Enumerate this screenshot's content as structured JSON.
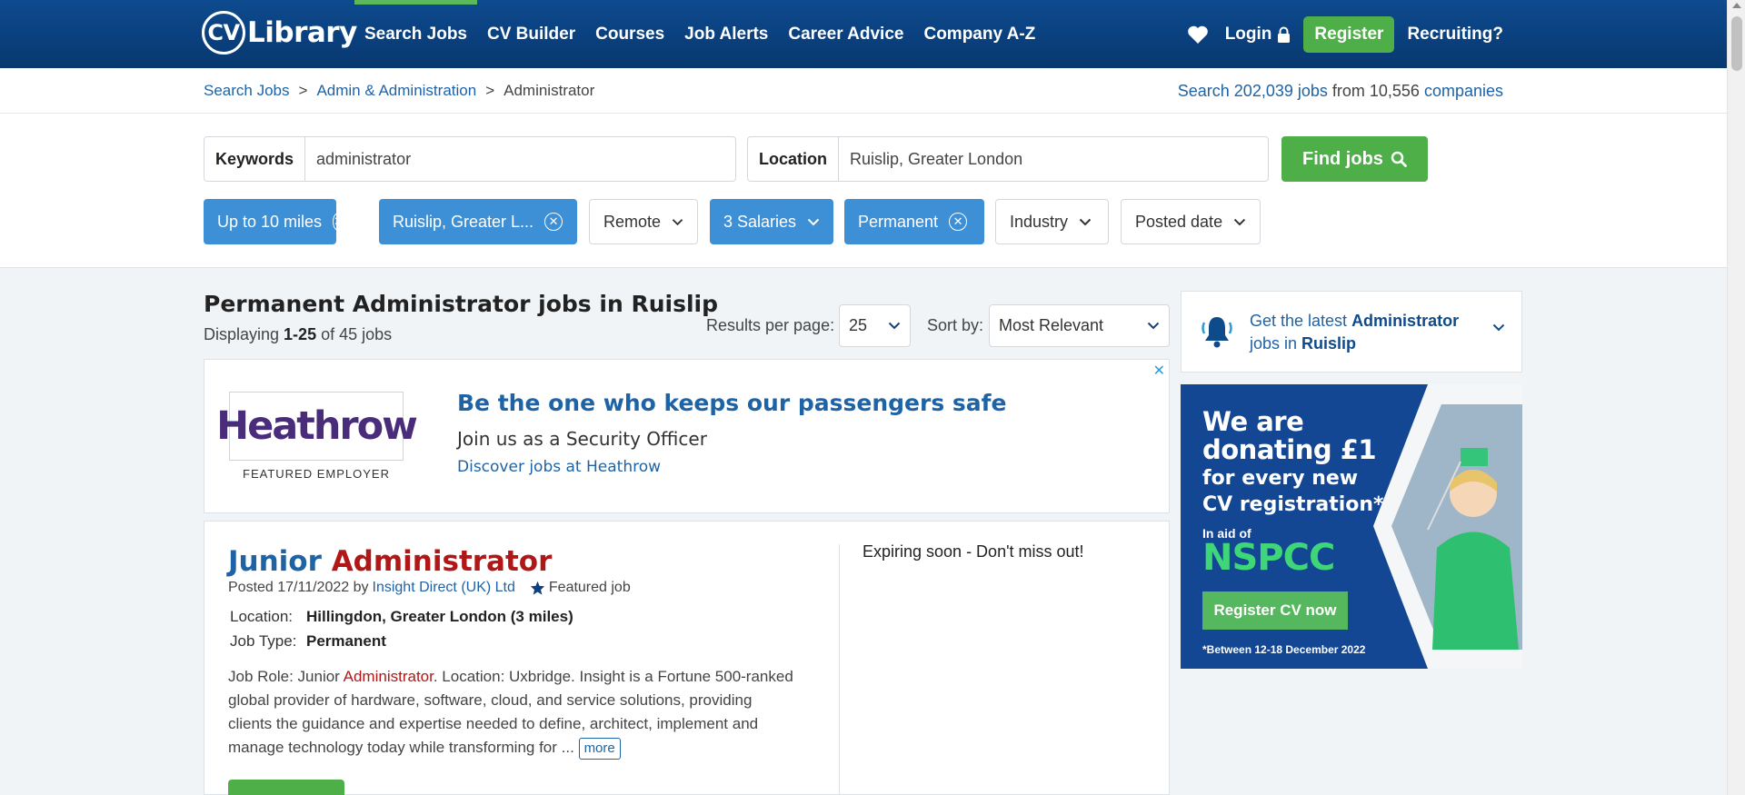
{
  "header": {
    "logo_text": "Library",
    "logo_badge": "CV",
    "nav": [
      "Search Jobs",
      "CV Builder",
      "Courses",
      "Job Alerts",
      "Career Advice",
      "Company A-Z"
    ],
    "login": "Login",
    "register": "Register",
    "recruiting": "Recruiting?"
  },
  "breadcrumb": {
    "items": [
      "Search Jobs",
      "Admin & Administration",
      "Administrator"
    ],
    "separator": ">"
  },
  "stats": {
    "prefix": "Search ",
    "jobs": "202,039 jobs",
    "middle": " from 10,556 ",
    "companies": "companies"
  },
  "search": {
    "keywords_label": "Keywords",
    "keywords_value": "administrator",
    "location_label": "Location",
    "location_value": "Ruislip, Greater London",
    "find_button": "Find jobs"
  },
  "filters": [
    {
      "label": "Up to 10 miles",
      "active": true
    },
    {
      "label": "Ruislip, Greater L...",
      "active": true
    },
    {
      "label": "Remote",
      "active": false
    },
    {
      "label": "3 Salaries",
      "active": true,
      "dropdown": true
    },
    {
      "label": "Permanent",
      "active": true
    },
    {
      "label": "Industry",
      "active": false
    },
    {
      "label": "Posted date",
      "active": false
    }
  ],
  "results": {
    "title": "Permanent Administrator jobs in Ruislip",
    "displaying_prefix": "Displaying ",
    "displaying_range": "1-25",
    "displaying_suffix": " of 45 jobs",
    "per_page_label": "Results per page:",
    "per_page_value": "25",
    "sort_label": "Sort by:",
    "sort_value": "Most Relevant"
  },
  "featured_employer": {
    "logo_text": "Heathrow",
    "tag": "FEATURED EMPLOYER",
    "headline": "Be the one who keeps our passengers safe",
    "subline": "Join us as a Security Officer",
    "link": "Discover jobs at Heathrow",
    "close": "✕"
  },
  "job": {
    "title_a": "Junior ",
    "title_b": "Administrator",
    "posted_prefix": "Posted 17/11/2022 by",
    "company": "Insight Direct (UK) Ltd",
    "featured_tag": "Featured job",
    "location_label": "Location:",
    "location_value": "Hillingdon, Greater London (3 miles)",
    "type_label": "Job Type:",
    "type_value": "Permanent",
    "desc_a": "Job Role: Junior ",
    "desc_hl": "Administrator",
    "desc_b": ". Location: Uxbridge. Insight is a Fortune 500-ranked global provider of hardware, software, cloud, and service solutions, providing clients the guidance and expertise needed to define, architect, implement and manage technology today while transforming for ...",
    "more": "more",
    "expiring": "Expiring soon - Don't miss out!"
  },
  "alert": {
    "prefix": "Get the latest ",
    "role": "Administrator",
    "middle": " jobs in ",
    "place": "Ruislip"
  },
  "ad": {
    "headline": "We are donating £1",
    "subline": "for every new CV registration*",
    "aid": "In aid of",
    "charity": "NSPCC",
    "button": "Register CV now",
    "footnote": "*Between 12-18 December 2022"
  },
  "colors": {
    "brand_blue": "#0d4a8f",
    "accent_green": "#4eae48",
    "chip_blue": "#3d8fd6",
    "link_blue": "#1e63a6",
    "highlight_red": "#b01818"
  }
}
